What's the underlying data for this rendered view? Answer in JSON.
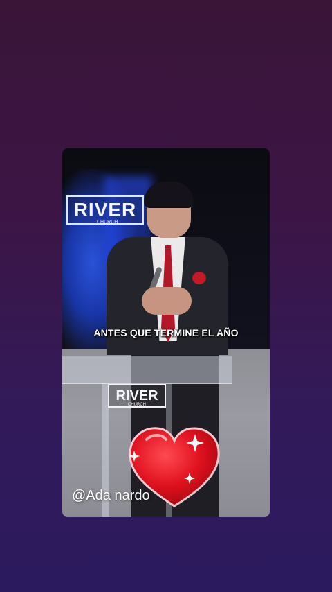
{
  "video": {
    "subtitle": "ANTES QUE TERMINE EL AÑO",
    "watermark": "@Ada nardo",
    "backdrop_logo": "RIVER",
    "backdrop_logo_sub": "CHURCH",
    "podium_logo": "RIVER",
    "podium_logo_sub": "CHURCH"
  },
  "sticker": {
    "icon": "heart-icon",
    "color": "#d8101e"
  },
  "colors": {
    "background_top": "#3a1538",
    "background_bottom": "#2b1a5e"
  }
}
